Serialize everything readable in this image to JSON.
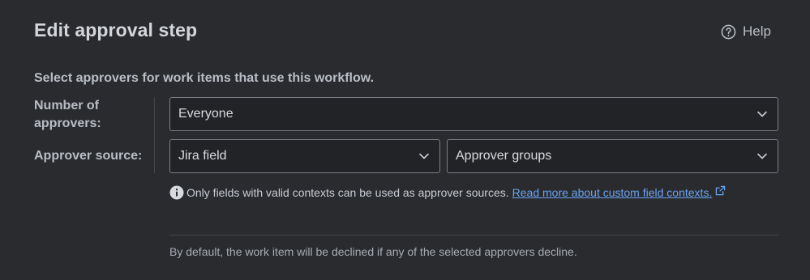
{
  "header": {
    "title": "Edit approval step",
    "help_label": "Help",
    "help_icon": "question-circle-icon"
  },
  "subtitle": "Select approvers for work items that use this workflow.",
  "form": {
    "number_label": "Number of approvers:",
    "number_value": "Everyone",
    "source_label": "Approver source:",
    "source_value": "Jira field",
    "field_value": "Approver groups",
    "chevron_icon": "chevron-down-icon"
  },
  "info": {
    "icon": "info-icon",
    "text": "Only fields with valid contexts can be used as approver sources.",
    "link_text": "Read more about custom field contexts.",
    "link_icon": "external-link-icon"
  },
  "footer": {
    "text": "By default, the work item will be declined if any of the selected approvers decline."
  },
  "colors": {
    "background": "#2a2b2e",
    "field_bg": "#222326",
    "field_border": "#7a7e86",
    "link": "#6aa3f2"
  }
}
